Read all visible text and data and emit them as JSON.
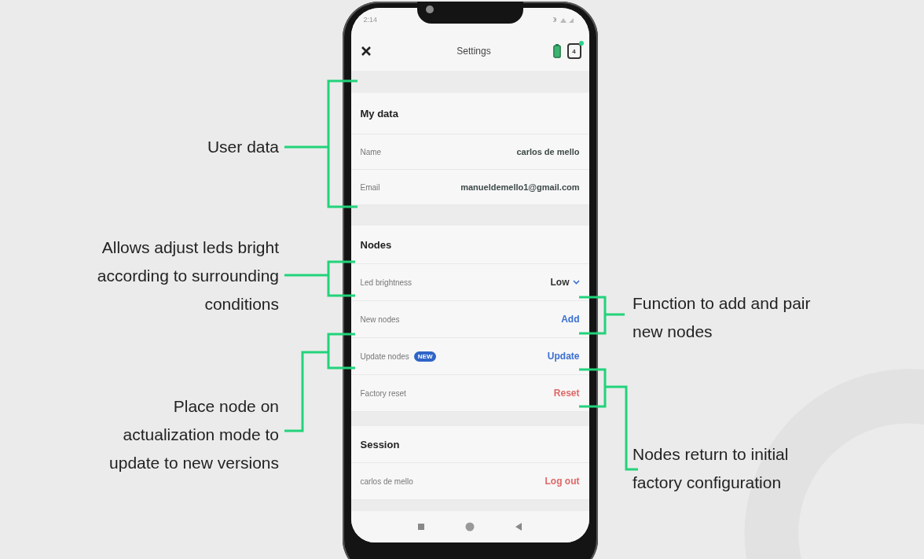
{
  "status_bar": {
    "time": "2:14"
  },
  "header": {
    "title": "Settings",
    "device_count": "4"
  },
  "sections": [
    {
      "title": "My data",
      "rows": [
        {
          "kind": "value",
          "label": "Name",
          "value": "carlos de mello"
        },
        {
          "kind": "value",
          "label": "Email",
          "value": "manueldemello1@gmail.com"
        }
      ]
    },
    {
      "title": "Nodes",
      "rows": [
        {
          "kind": "dropdown",
          "label": "Led brightness",
          "value": "Low"
        },
        {
          "kind": "action",
          "label": "New nodes",
          "action": "Add",
          "color": "#3b6fd1"
        },
        {
          "kind": "action",
          "label": "Update nodes",
          "badge": "NEW",
          "action": "Update",
          "color": "#3b6fd1"
        },
        {
          "kind": "action",
          "label": "Factory reset",
          "action": "Reset",
          "color": "#e06868"
        }
      ]
    },
    {
      "title": "Session",
      "rows": [
        {
          "kind": "action",
          "label": "carlos de mello",
          "action": "Log out",
          "color": "#e06868"
        }
      ]
    }
  ],
  "annotations": [
    {
      "lines": [
        "User data"
      ]
    },
    {
      "lines": [
        "Allows adjust leds bright",
        "according to surrounding",
        "conditions"
      ]
    },
    {
      "lines": [
        "Place node on",
        "actualization mode to",
        "update to new versions"
      ]
    },
    {
      "lines": [
        "Function to add and pair",
        "new nodes"
      ]
    },
    {
      "lines": [
        "Nodes return to initial",
        "factory configuration"
      ]
    }
  ]
}
